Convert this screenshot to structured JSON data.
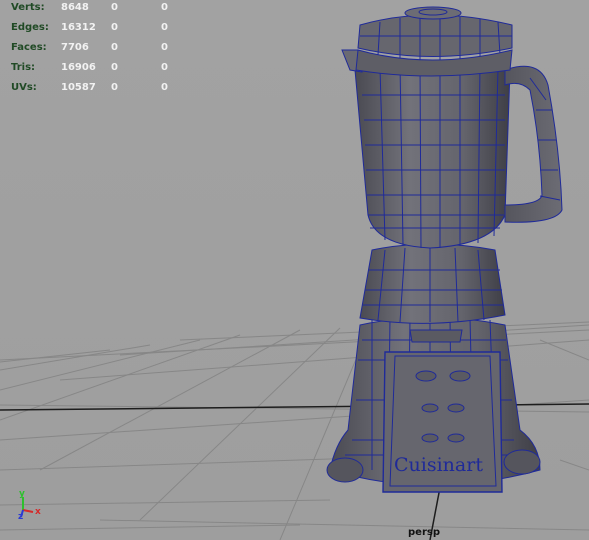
{
  "hud": {
    "rows": [
      {
        "label": "Verts:",
        "a": "8648",
        "b": "0",
        "c": "0"
      },
      {
        "label": "Edges:",
        "a": "16312",
        "b": "0",
        "c": "0"
      },
      {
        "label": "Faces:",
        "a": "7706",
        "b": "0",
        "c": "0"
      },
      {
        "label": "Tris:",
        "a": "16906",
        "b": "0",
        "c": "0"
      },
      {
        "label": "UVs:",
        "a": "10587",
        "b": "0",
        "c": "0"
      }
    ]
  },
  "viewport": {
    "camera_label": "persp",
    "grid": "on",
    "model_brand_label": "Cuisinart"
  },
  "axis_indicator": {
    "x": "x",
    "y": "y",
    "z": "z",
    "colors": {
      "x": "#d42a2a",
      "y": "#2ec02e",
      "z": "#2a3ad4"
    }
  },
  "colors": {
    "background": "#a0a0a0",
    "grid": "#8a8a8a",
    "wire": "#1f2a99",
    "mesh": "#5e5e66"
  }
}
